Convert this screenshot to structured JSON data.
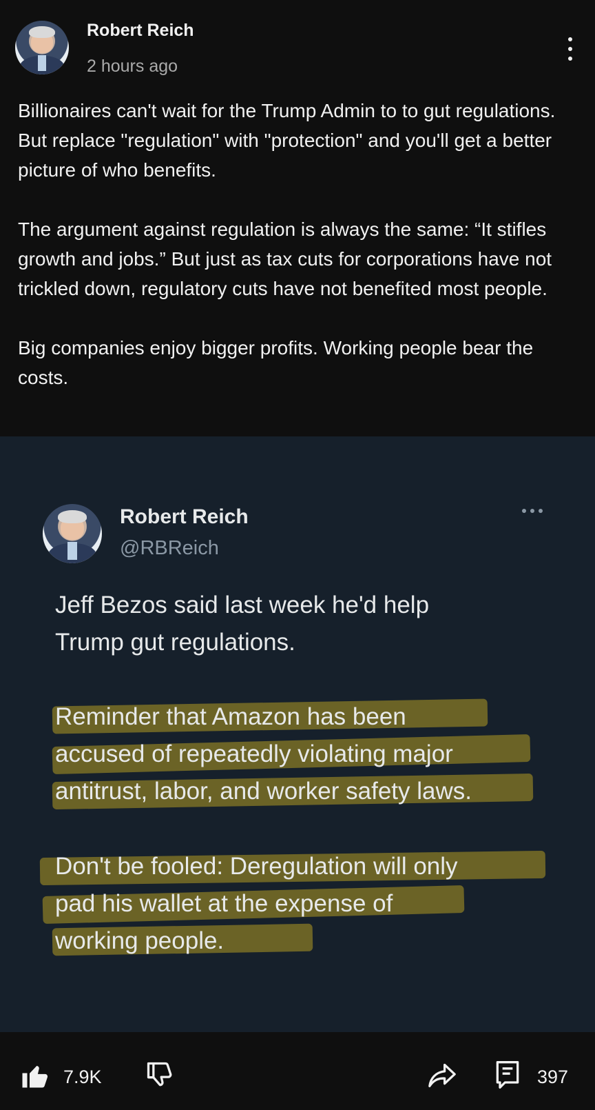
{
  "post": {
    "author": "Robert Reich",
    "time": "2 hours ago",
    "paragraphs": [
      "Billionaires can't wait for the Trump Admin to to gut regulations. But replace \"regulation\" with \"protection\" and you'll get a better picture of who benefits.",
      "The argument against regulation is always the same: “It stifles growth and jobs.” But just as tax cuts for corporations have not trickled down, regulatory cuts have not benefited most people.",
      "Big companies enjoy bigger profits. Working people bear the costs."
    ]
  },
  "tweet": {
    "name": "Robert Reich",
    "handle": "@RBReich",
    "para1": [
      "Jeff Bezos said last week he'd help",
      "Trump gut regulations."
    ],
    "para2": [
      "Reminder that Amazon has been",
      "accused of repeatedly violating major",
      "antitrust, labor, and worker safety laws."
    ],
    "para3": [
      "Don't be fooled: Deregulation will only",
      "pad his wallet at the expense of",
      "working people."
    ],
    "highlight_color": "#a08c23"
  },
  "actions": {
    "likes": "7.9K",
    "comments": "397",
    "icons": [
      "thumbs-up-icon",
      "thumbs-down-icon",
      "share-icon",
      "comment-icon"
    ]
  }
}
